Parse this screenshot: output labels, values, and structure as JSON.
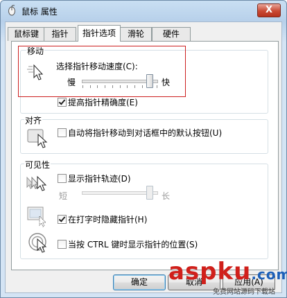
{
  "window": {
    "title": "鼠标 属性",
    "close_label": "X"
  },
  "tabs": [
    {
      "label": "鼠标键"
    },
    {
      "label": "指针"
    },
    {
      "label": "指针选项"
    },
    {
      "label": "滑轮"
    },
    {
      "label": "硬件"
    }
  ],
  "active_tab": 2,
  "motion": {
    "group_label": "移动",
    "speed_label": "选择指针移动速度(C):",
    "slow_label": "慢",
    "fast_label": "快",
    "speed_level_fraction": 0.9,
    "precision_label": "提高指针精确度(E)",
    "precision_checked": true
  },
  "snap": {
    "group_label": "对齐",
    "label": "自动将指针移动到对话框中的默认按钮(U)",
    "checked": false
  },
  "visibility": {
    "group_label": "可见性",
    "trails_label": "显示指针轨迹(D)",
    "trails_checked": false,
    "short_label": "短",
    "long_label": "长",
    "trails_level_fraction": 0.9,
    "hide_typing_label": "在打字时隐藏指针(H)",
    "hide_typing_checked": true,
    "ctrl_label": "当按 CTRL 键时显示指针的位置(S)",
    "ctrl_checked": false
  },
  "buttons": {
    "ok": "确定",
    "cancel": "取消",
    "apply": "应用(A)"
  },
  "watermark": {
    "brand": "aspku",
    "tld": ".com",
    "caption": "免费网站源码下载站"
  },
  "colors": {
    "highlight_box": "#cc1e1e",
    "watermark_red": "#d0201b",
    "watermark_blue": "#1c5fb8"
  }
}
